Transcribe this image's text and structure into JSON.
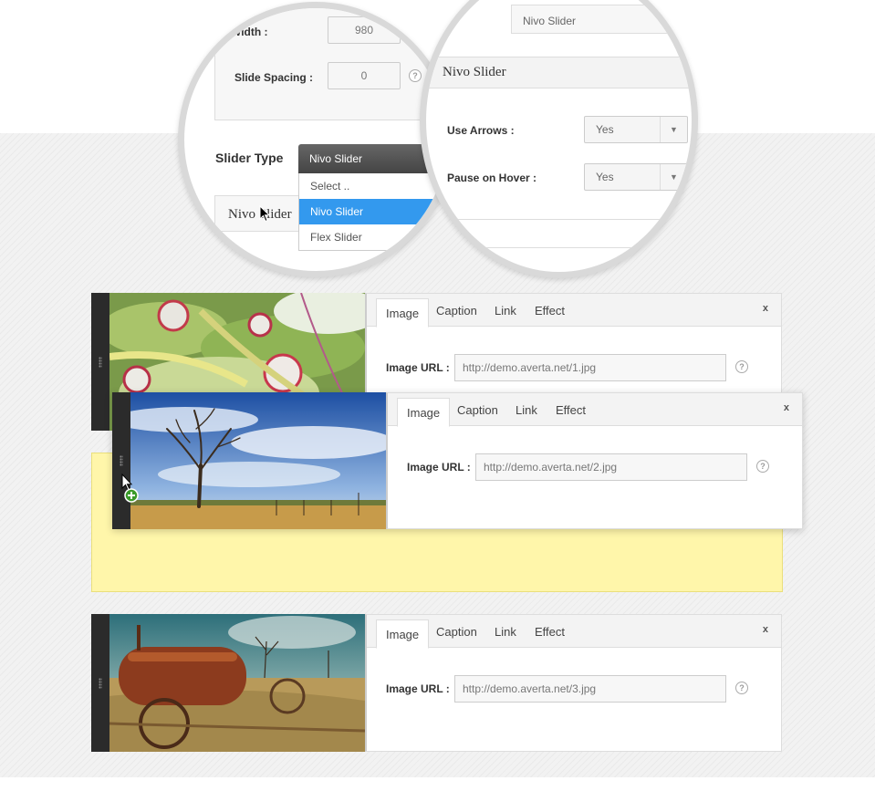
{
  "zoom_a": {
    "width_label": "Width :",
    "width_value": "980",
    "spacing_label": "Slide Spacing :",
    "spacing_value": "0",
    "help_glyph": "?",
    "slider_type_label": "Slider Type",
    "dropdown": {
      "selected": "Nivo Slider",
      "options": [
        "Select ..",
        "Nivo Slider",
        "Flex Slider"
      ]
    },
    "section_title": "Nivo Slider"
  },
  "zoom_b": {
    "top_field_value": "Nivo Slider",
    "section_title": "Nivo Slider",
    "use_arrows_label": "Use Arrows :",
    "use_arrows_value": "Yes",
    "pause_label": "Pause on Hover :",
    "pause_value": "Yes"
  },
  "tabs": [
    "Image",
    "Caption",
    "Link",
    "Effect"
  ],
  "close_glyph": "x",
  "image_url_label": "Image URL :",
  "slides": [
    {
      "url": "http://demo.averta.net/1.jpg"
    },
    {
      "url": "http://demo.averta.net/2.jpg"
    },
    {
      "url": "http://demo.averta.net/3.jpg"
    }
  ],
  "colors": {
    "drop_zone": "#fff6aa",
    "selected_option": "#3399ee",
    "handle": "#2b2b2b"
  }
}
